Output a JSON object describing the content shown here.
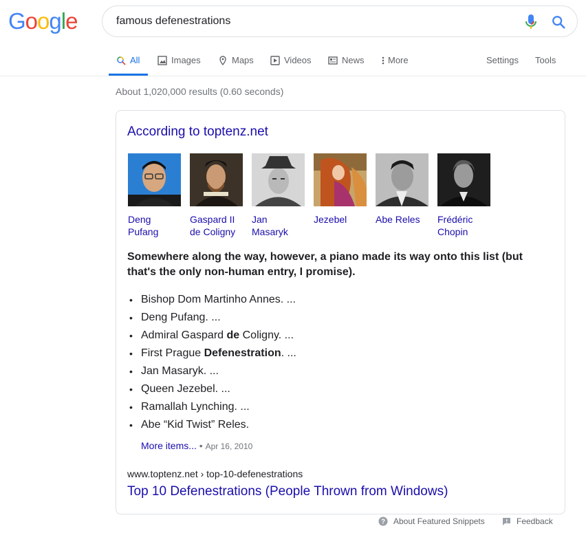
{
  "logo": {
    "text": "Google",
    "letters": [
      "G",
      "o",
      "o",
      "g",
      "l",
      "e"
    ],
    "colors": [
      "#4285f4",
      "#ea4335",
      "#fbbc05",
      "#4285f4",
      "#34a853",
      "#ea4335"
    ]
  },
  "search": {
    "query": "famous defenestrations"
  },
  "tabs": [
    {
      "label": "All",
      "icon": "search-icon"
    },
    {
      "label": "Images",
      "icon": "image-icon"
    },
    {
      "label": "Maps",
      "icon": "map-pin-icon"
    },
    {
      "label": "Videos",
      "icon": "video-icon"
    },
    {
      "label": "News",
      "icon": "news-icon"
    },
    {
      "label": "More",
      "icon": "more-vert-icon"
    },
    {
      "label": "Settings"
    },
    {
      "label": "Tools"
    }
  ],
  "stats": "About 1,020,000 results (0.60 seconds)",
  "featured": {
    "source_title": "According to toptenz.net",
    "people": [
      {
        "name": "Deng Pufang",
        "line1": "Deng",
        "line2": "Pufang"
      },
      {
        "name": "Gaspard II de Coligny",
        "line1": "Gaspard II",
        "line2": "de Coligny"
      },
      {
        "name": "Jan Masaryk",
        "line1": "Jan",
        "line2": "Masaryk"
      },
      {
        "name": "Jezebel",
        "line1": "Jezebel",
        "line2": ""
      },
      {
        "name": "Abe Reles",
        "line1": "Abe Reles",
        "line2": ""
      },
      {
        "name": "Frédéric Chopin",
        "line1": "Frédéric",
        "line2": "Chopin"
      }
    ],
    "headline": "Somewhere along the way, however, a piano made its way onto this list (but that's the only non-human entry, I promise).",
    "list": [
      {
        "pre": "Bishop Dom Martinho Annes. ...",
        "bold": "",
        "post": ""
      },
      {
        "pre": "Deng Pufang. ...",
        "bold": "",
        "post": ""
      },
      {
        "pre": "Admiral Gaspard ",
        "bold": "de",
        "post": " Coligny. ..."
      },
      {
        "pre": "First Prague ",
        "bold": "Defenestration",
        "post": ". ..."
      },
      {
        "pre": "Jan Masaryk. ...",
        "bold": "",
        "post": ""
      },
      {
        "pre": "Queen Jezebel. ...",
        "bold": "",
        "post": ""
      },
      {
        "pre": "Ramallah Lynching. ...",
        "bold": "",
        "post": ""
      },
      {
        "pre": "Abe “Kid Twist” Reles.",
        "bold": "",
        "post": ""
      }
    ],
    "more_items": "More items...",
    "separator": " • ",
    "date": "Apr 16, 2010",
    "cite": "www.toptenz.net › top-10-defenestrations",
    "result_title": "Top 10 Defenestrations (People Thrown from Windows)"
  },
  "footer": {
    "about": "About Featured Snippets",
    "feedback": "Feedback"
  },
  "colors": {
    "link": "#1a0dab",
    "accent": "#1a73e8",
    "muted": "#70757a"
  }
}
